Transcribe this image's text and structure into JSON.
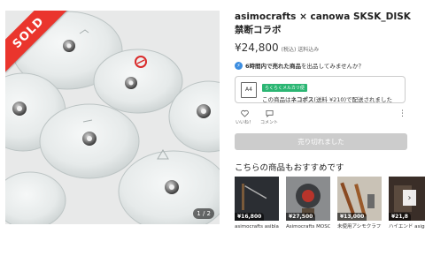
{
  "item": {
    "title": "asimocrafts × canowa SKSK_DISK禁断コラボ",
    "price": "¥24,800",
    "tax_note": "(税込) 送料込み",
    "sold_label": "SOLD",
    "photo_counter": "1 / 2"
  },
  "promo": {
    "bold": "6時間内で売れた商品",
    "text": "を出品してみませんか？"
  },
  "shipping": {
    "icon_label": "A4",
    "badge": "らくらくメルカリ便",
    "desc_prefix": "この商品は",
    "desc_bold": "ネコポス",
    "desc_suffix": "(送料 ¥210)で配送されました"
  },
  "actions": {
    "like": "いいね！",
    "comment": "コメント",
    "more": "⋮"
  },
  "buy_button": "売り切れました",
  "recommend": {
    "title": "こちらの商品もおすすめです",
    "items": [
      {
        "price": "¥16,800",
        "name": "asimocrafts asiblaster アシブ"
      },
      {
        "price": "¥27,500",
        "name": "Asimocrafts MOSCO-KEZUR"
      },
      {
        "price": "¥13,000",
        "name": "未使用アシモクラフツ asimocrafts"
      },
      {
        "price": "¥21,8",
        "name": "ハイエンド asigr"
      }
    ]
  },
  "colors": {
    "sold_ribbon": "#ea352d",
    "ship_badge": "#2bb673",
    "disabled_button": "#cccccc"
  }
}
